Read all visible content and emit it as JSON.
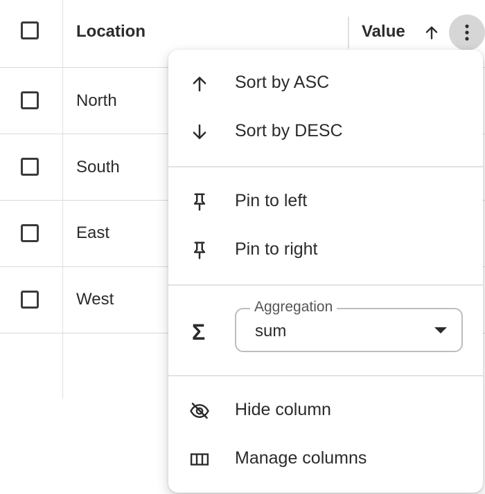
{
  "grid": {
    "columns": {
      "location": "Location",
      "value": "Value"
    },
    "sort_direction": "ascending",
    "rows": [
      {
        "location": "North"
      },
      {
        "location": "South"
      },
      {
        "location": "East"
      },
      {
        "location": "West"
      }
    ]
  },
  "column_menu": {
    "sort_asc": "Sort by ASC",
    "sort_desc": "Sort by DESC",
    "pin_left": "Pin to left",
    "pin_right": "Pin to right",
    "aggregation": {
      "label": "Aggregation",
      "value": "sum",
      "icon": "sigma-icon"
    },
    "hide_column": "Hide column",
    "manage_columns": "Manage columns"
  },
  "colors": {
    "menu_button_active": "#d6d6d6",
    "text": "#2b2b2b",
    "divider": "#e2e2e2"
  }
}
